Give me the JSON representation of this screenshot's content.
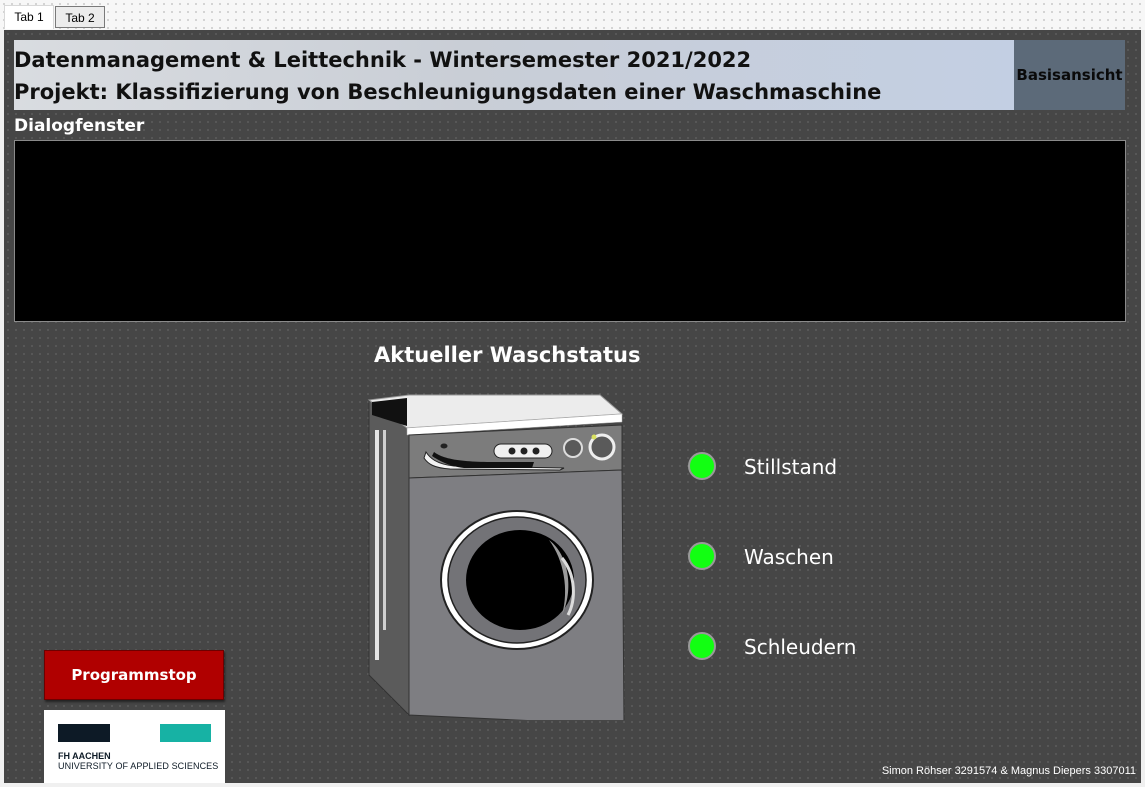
{
  "tabs": [
    {
      "label": "Tab 1"
    },
    {
      "label": "Tab 2"
    }
  ],
  "header": {
    "title_line1": "Datenmanagement & Leittechnik - Wintersemester 2021/2022",
    "title_line2": "Projekt: Klassifizierung von Beschleunigungsdaten einer Waschmaschine",
    "view_button": "Basisansicht"
  },
  "dialog": {
    "label": "Dialogfenster",
    "content": ""
  },
  "status": {
    "title": "Aktueller Waschstatus",
    "indicators": [
      {
        "label": "Stillstand",
        "color": "#12ff12"
      },
      {
        "label": "Waschen",
        "color": "#12ff12"
      },
      {
        "label": "Schleudern",
        "color": "#12ff12"
      }
    ]
  },
  "controls": {
    "stop_button": "Programmstop"
  },
  "logo": {
    "line1": "FH AACHEN",
    "line2": "UNIVERSITY OF APPLIED SCIENCES"
  },
  "footer": {
    "credits": "Simon Röhser 3291574 & Magnus Diepers 3307011"
  },
  "colors": {
    "panel_bg": "#464646",
    "stop": "#b00000",
    "indicator_on": "#12ff12",
    "view_button": "#5c6a79"
  }
}
